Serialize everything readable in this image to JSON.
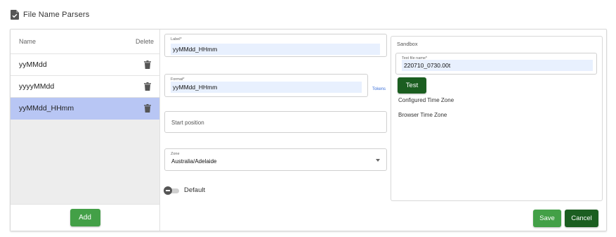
{
  "header": {
    "title": "File Name Parsers",
    "icon": "file-check-icon"
  },
  "list": {
    "col_name": "Name",
    "col_delete": "Delete",
    "items": [
      {
        "name": "yyMMdd",
        "selected": false
      },
      {
        "name": "yyyyMMdd",
        "selected": false
      },
      {
        "name": "yyMMdd_HHmm",
        "selected": true
      }
    ],
    "add_label": "Add"
  },
  "form": {
    "label_field": {
      "label": "Label*",
      "value": "yyMMdd_HHmm"
    },
    "format_field": {
      "label": "Format*",
      "value": "yyMMdd_HHmm",
      "tokens_link": "Tokens"
    },
    "start_position": {
      "placeholder": "Start position"
    },
    "zone": {
      "label": "Zone",
      "value": "Australia/Adelaide"
    },
    "default_toggle": {
      "label": "Default",
      "on": false
    }
  },
  "sandbox": {
    "title": "Sandbox",
    "test_file": {
      "label": "Test file name*",
      "value": "220710_0730.00t"
    },
    "test_label": "Test",
    "configured_tz_label": "Configured Time Zone",
    "browser_tz_label": "Browser Time Zone"
  },
  "actions": {
    "save_label": "Save",
    "cancel_label": "Cancel"
  },
  "colors": {
    "selected_row": "#b8c6f4",
    "green": "#43a047",
    "dark_green": "#1b5e20",
    "autofill": "#e8f0fe"
  }
}
